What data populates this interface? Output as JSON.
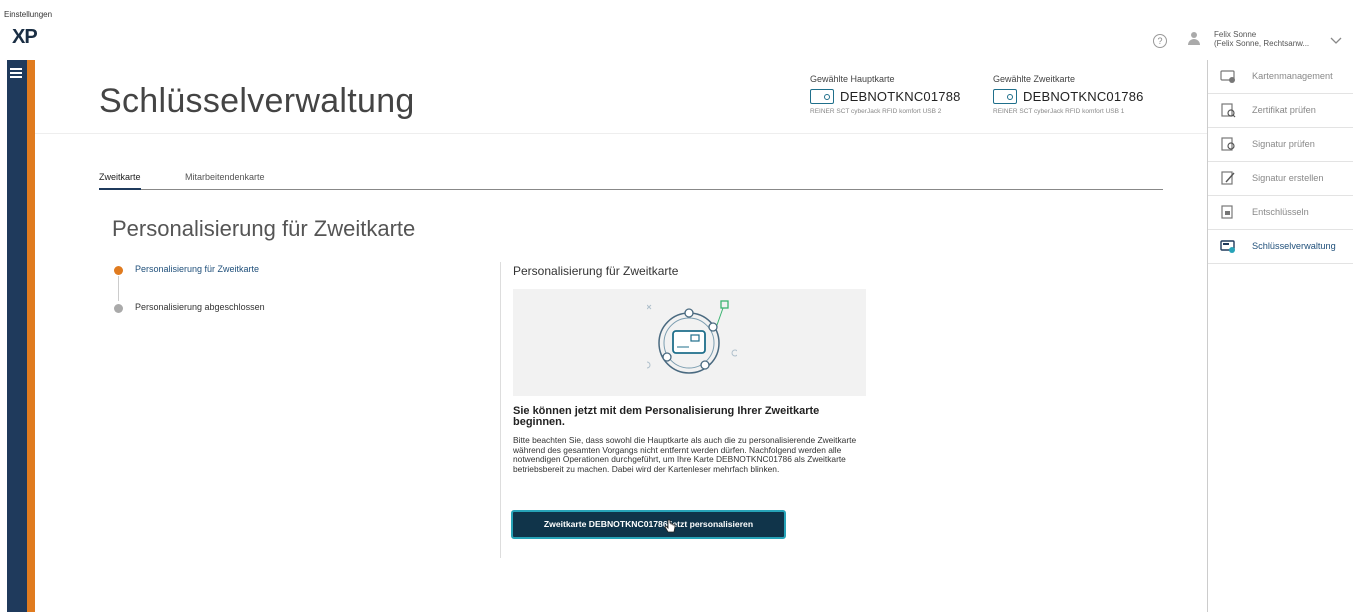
{
  "window": {
    "menu_label": "Einstellungen",
    "logo_text": "XP",
    "user_name": "Felix Sonne",
    "user_sub": "(Felix Sonne, Rechtsanw..."
  },
  "header": {
    "title": "Schlüsselverwaltung",
    "primary_card": {
      "label": "Gewählte Hauptkarte",
      "id": "DEBNOTKNC01788",
      "reader": "REINER SCT cyberJack RFID komfort USB 2"
    },
    "secondary_card": {
      "label": "Gewählte Zweitkarte",
      "id": "DEBNOTKNC01786",
      "reader": "REINER SCT cyberJack RFID komfort USB 1"
    }
  },
  "tabs": [
    {
      "label": "Zweitkarte",
      "active": true
    },
    {
      "label": "Mitarbeitendenkarte",
      "active": false
    }
  ],
  "section": {
    "title": "Personalisierung für Zweitkarte"
  },
  "steps": [
    {
      "label": "Personalisierung für Zweitkarte",
      "state": "active"
    },
    {
      "label": "Personalisierung abgeschlossen",
      "state": "pending"
    }
  ],
  "panel": {
    "title": "Personalisierung für Zweitkarte",
    "heading": "Sie können jetzt mit dem Personalisierung Ihrer Zweitkarte beginnen.",
    "body": "Bitte beachten Sie, dass sowohl die Hauptkarte als auch die zu personalisierende Zweitkarte während des gesamten Vorgangs nicht entfernt werden dürfen. Nachfolgend werden alle notwendigen Operationen durchgeführt, um Ihre Karte DEBNOTKNC01786 als Zweitkarte betriebsbereit zu machen. Dabei wird der Kartenleser mehrfach blinken.",
    "button_label": "Zweitkarte DEBNOTKNC01786 jetzt personalisieren"
  },
  "side_menu": [
    {
      "label": "Kartenmanagement",
      "icon": "card-management-icon",
      "active": false
    },
    {
      "label": "Zertifikat prüfen",
      "icon": "certificate-icon",
      "active": false
    },
    {
      "label": "Signatur prüfen",
      "icon": "signature-check-icon",
      "active": false
    },
    {
      "label": "Signatur erstellen",
      "icon": "signature-create-icon",
      "active": false
    },
    {
      "label": "Entschlüsseln",
      "icon": "decrypt-icon",
      "active": false
    },
    {
      "label": "Schlüsselverwaltung",
      "icon": "key-management-icon",
      "active": true
    }
  ],
  "colors": {
    "accent_orange": "#e07b1f",
    "rail_navy": "#1f3a5c",
    "button_bg": "#10344a",
    "button_border": "#27a3b8"
  }
}
